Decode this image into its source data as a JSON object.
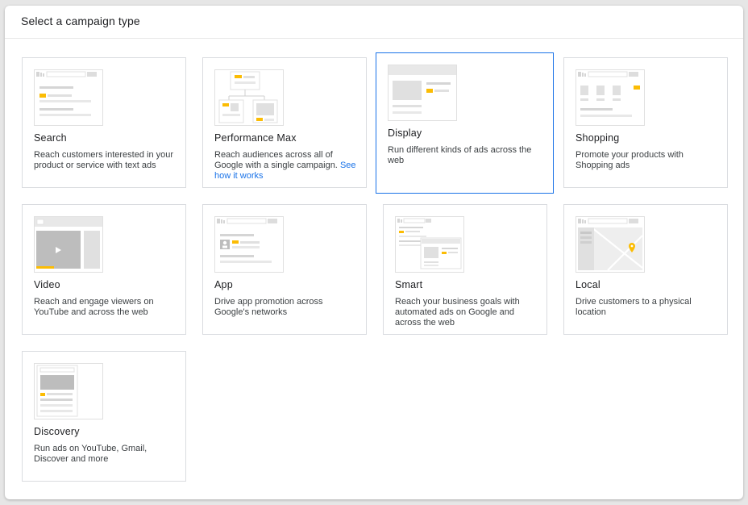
{
  "header": {
    "title": "Select a campaign type"
  },
  "colors": {
    "accent": "#1a73e8",
    "highlight": "#fbbc04",
    "frame": "#e0e0e0"
  },
  "cards": [
    {
      "title": "Search",
      "desc": "Reach customers interested in your product or service with text ads"
    },
    {
      "title": "Performance Max",
      "desc": "Reach audiences across all of Google with a single campaign.",
      "link": "See how it works"
    },
    {
      "title": "Display",
      "desc": "Run different kinds of ads across the web",
      "selected": true
    },
    {
      "title": "Shopping",
      "desc": "Promote your products with Shopping ads"
    },
    {
      "title": "Video",
      "desc": "Reach and engage viewers on YouTube and across the web"
    },
    {
      "title": "App",
      "desc": "Drive app promotion across Google's networks"
    },
    {
      "title": "Smart",
      "desc": "Reach your business goals with automated ads on Google and across the web"
    },
    {
      "title": "Local",
      "desc": "Drive customers to a physical location"
    },
    {
      "title": "Discovery",
      "desc": "Run ads on YouTube, Gmail, Discover and more"
    }
  ]
}
